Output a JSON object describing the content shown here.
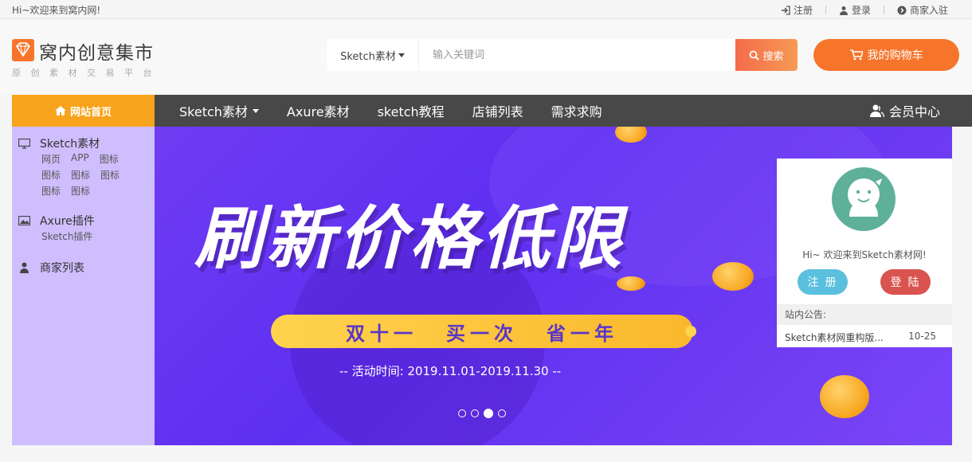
{
  "topbar": {
    "welcome": "Hi~欢迎来到窝内网!",
    "links": [
      {
        "label": "注册",
        "icon": "sign-in-icon"
      },
      {
        "label": "登录",
        "icon": "user-icon"
      },
      {
        "label": "商家入驻",
        "icon": "arrow-circle-icon"
      }
    ]
  },
  "logo": {
    "title": "窝内创意集市",
    "slogan": "原创素材交易平台",
    "color": "#f7752b"
  },
  "search": {
    "category": "Sketch素材",
    "placeholder": "输入关键词",
    "button": "搜索"
  },
  "cart": {
    "label": "我的购物车",
    "icon": "shopping-cart-icon"
  },
  "nav": {
    "home": "网站首页",
    "items": [
      {
        "label": "Sketch素材",
        "dropdown": true
      },
      {
        "label": "Axure素材",
        "dropdown": false
      },
      {
        "label": "sketch教程",
        "dropdown": false
      },
      {
        "label": "店铺列表",
        "dropdown": false
      },
      {
        "label": "需求求购",
        "dropdown": false
      }
    ],
    "member": "会员中心"
  },
  "sidemenu": {
    "groups": [
      {
        "title": "Sketch素材",
        "icon": "monitor-icon",
        "rows": [
          [
            "网页",
            "APP",
            "图标"
          ],
          [
            "图标",
            "图标",
            "图标"
          ],
          [
            "图标",
            "图标"
          ]
        ]
      },
      {
        "title": "Axure插件",
        "icon": "image-icon",
        "rows": [
          [
            "Sketch插件"
          ]
        ]
      },
      {
        "title": "商家列表",
        "icon": "user-icon",
        "rows": []
      }
    ]
  },
  "banner": {
    "headline": "刷新价格低限",
    "pill": [
      "双十一",
      "买一次",
      "省一年"
    ],
    "time": "-- 活动时间: 2019.11.01-2019.11.30 --",
    "slides": 4,
    "active_slide": 3
  },
  "userpanel": {
    "greeting": "Hi~ 欢迎来到Sketch素材网!",
    "register": "注册",
    "login": "登陆",
    "notice_header": "站内公告:",
    "notice": {
      "title": "Sketch素材网重构版...",
      "date": "10-25"
    }
  }
}
